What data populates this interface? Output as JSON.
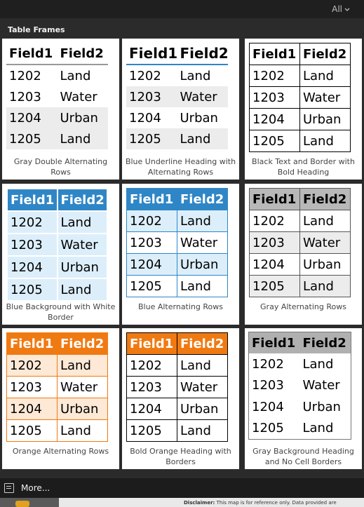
{
  "header": {
    "filter_label": "All",
    "section_title": "Table Frames"
  },
  "tiles": [
    {
      "name": "gray-double-alternating",
      "caption": "Gray Double Alternating Rows",
      "rows": [
        [
          "Field1",
          "Field2"
        ],
        [
          "1202",
          "Land"
        ],
        [
          "1203",
          "Water"
        ],
        [
          "1204",
          "Urban"
        ],
        [
          "1205",
          "Land"
        ]
      ]
    },
    {
      "name": "blue-underline-heading",
      "caption": "Blue Underline Heading with Alternating Rows",
      "rows": [
        [
          "Field1",
          "Field2"
        ],
        [
          "1202",
          "Land"
        ],
        [
          "1203",
          "Water"
        ],
        [
          "1204",
          "Urban"
        ],
        [
          "1205",
          "Land"
        ]
      ]
    },
    {
      "name": "black-text-border",
      "caption": "Black Text and Border with Bold Heading",
      "rows": [
        [
          "Field1",
          "Field2"
        ],
        [
          "1202",
          "Land"
        ],
        [
          "1203",
          "Water"
        ],
        [
          "1204",
          "Urban"
        ],
        [
          "1205",
          "Land"
        ]
      ]
    },
    {
      "name": "blue-background-white-border",
      "caption": "Blue Background with White Border",
      "rows": [
        [
          "Field1",
          "Field2"
        ],
        [
          "1202",
          "Land"
        ],
        [
          "1203",
          "Water"
        ],
        [
          "1204",
          "Urban"
        ],
        [
          "1205",
          "Land"
        ]
      ]
    },
    {
      "name": "blue-alternating",
      "caption": "Blue Alternating Rows",
      "rows": [
        [
          "Field1",
          "Field2"
        ],
        [
          "1202",
          "Land"
        ],
        [
          "1203",
          "Water"
        ],
        [
          "1204",
          "Urban"
        ],
        [
          "1205",
          "Land"
        ]
      ]
    },
    {
      "name": "gray-alternating",
      "caption": "Gray Alternating Rows",
      "rows": [
        [
          "Field1",
          "Field2"
        ],
        [
          "1202",
          "Land"
        ],
        [
          "1203",
          "Water"
        ],
        [
          "1204",
          "Urban"
        ],
        [
          "1205",
          "Land"
        ]
      ]
    },
    {
      "name": "orange-alternating",
      "caption": "Orange Alternating Rows",
      "rows": [
        [
          "Field1",
          "Field2"
        ],
        [
          "1202",
          "Land"
        ],
        [
          "1203",
          "Water"
        ],
        [
          "1204",
          "Urban"
        ],
        [
          "1205",
          "Land"
        ]
      ]
    },
    {
      "name": "bold-orange-heading",
      "caption": "Bold Orange Heading with Borders",
      "rows": [
        [
          "Field1",
          "Field2"
        ],
        [
          "1202",
          "Land"
        ],
        [
          "1203",
          "Water"
        ],
        [
          "1204",
          "Urban"
        ],
        [
          "1205",
          "Land"
        ]
      ]
    },
    {
      "name": "gray-background-no-borders",
      "caption": "Gray Background Heading and No Cell Borders",
      "rows": [
        [
          "Field1",
          "Field2"
        ],
        [
          "1202",
          "Land"
        ],
        [
          "1203",
          "Water"
        ],
        [
          "1204",
          "Urban"
        ],
        [
          "1205",
          "Land"
        ]
      ]
    }
  ],
  "footer": {
    "more_label": "More...",
    "disclaimer_label": "Disclaimer:",
    "disclaimer_text": "This map is for reference only. Data provided are"
  },
  "colors": {
    "blue": "#2f86c6",
    "light_blue": "#dceefa",
    "orange": "#f07a12",
    "light_orange": "#fde9d6",
    "gray_header": "#b8b8b8",
    "gray_row": "#ececec"
  }
}
